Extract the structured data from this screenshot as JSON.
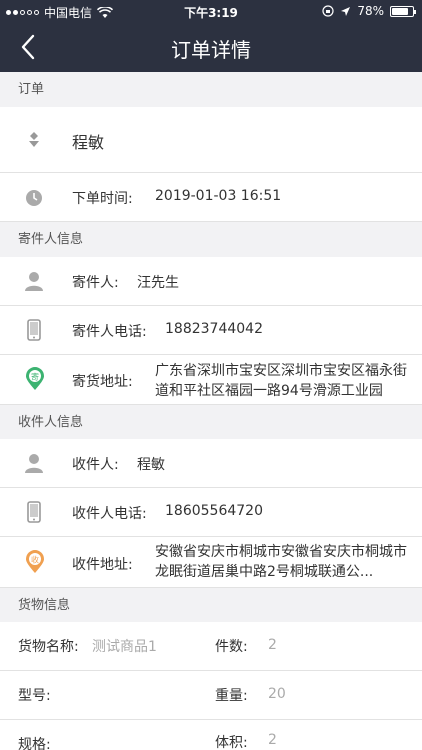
{
  "status": {
    "carrier": "中国电信",
    "time": "下午3:19",
    "battery": "78%",
    "battery_level": 0.78
  },
  "nav": {
    "title": "订单详情"
  },
  "order": {
    "section": "订单",
    "name": "程敏",
    "time_label": "下单时间:",
    "time_value": "2019-01-03 16:51"
  },
  "sender": {
    "section": "寄件人信息",
    "name_label": "寄件人:",
    "name_value": "汪先生",
    "phone_label": "寄件人电话:",
    "phone_value": "18823744042",
    "address_label": "寄货地址:",
    "address_value": "广东省深圳市宝安区深圳市宝安区福永街道和平社区福园一路94号滑源工业园",
    "badge": "寄"
  },
  "receiver": {
    "section": "收件人信息",
    "name_label": "收件人:",
    "name_value": "程敏",
    "phone_label": "收件人电话:",
    "phone_value": "18605564720",
    "address_label": "收件地址:",
    "address_value": "安徽省安庆市桐城市安徽省安庆市桐城市龙眠街道居巢中路2号桐城联通公...",
    "badge": "收"
  },
  "goods": {
    "section": "货物信息",
    "name_label": "货物名称:",
    "name_value": "测试商品1",
    "count_label": "件数:",
    "count_value": "2",
    "model_label": "型号:",
    "model_value": "",
    "weight_label": "重量:",
    "weight_value": "20",
    "spec_label": "规格:",
    "spec_value": "",
    "volume_label": "体积:",
    "volume_value": "2"
  },
  "colors": {
    "header": "#2c3140",
    "sender_badge": "#3cb371",
    "receiver_badge": "#f0a050"
  }
}
